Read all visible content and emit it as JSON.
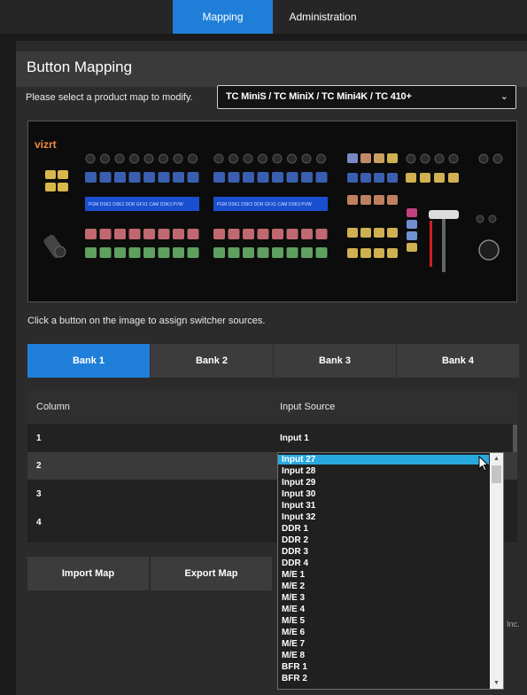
{
  "nav": {
    "tabs": [
      {
        "label": "Mapping",
        "active": true
      },
      {
        "label": "Administration",
        "active": false
      }
    ]
  },
  "panel": {
    "title": "Button Mapping"
  },
  "product": {
    "label": "Please select a product map to modify.",
    "selected": "TC MiniS / TC MiniX / TC Mini4K / TC 410+"
  },
  "device": {
    "logo": "vizrt",
    "row_labels": [
      "PGM",
      "DSK1",
      "DSK2",
      "DDR",
      "GFX1",
      "CAM",
      "DSK3",
      "PVW"
    ]
  },
  "hint": "Click a button on the image to assign switcher sources.",
  "banks": [
    {
      "label": "Bank 1",
      "active": true
    },
    {
      "label": "Bank 2",
      "active": false
    },
    {
      "label": "Bank 3",
      "active": false
    },
    {
      "label": "Bank 4",
      "active": false
    }
  ],
  "table": {
    "headers": {
      "column": "Column",
      "source": "Input Source"
    },
    "rows": [
      {
        "column": "1",
        "source": "Input 1"
      },
      {
        "column": "2",
        "source": ""
      },
      {
        "column": "3",
        "source": ""
      },
      {
        "column": "4",
        "source": ""
      }
    ]
  },
  "actions": {
    "import": "Import Map",
    "export": "Export Map"
  },
  "footer": {
    "copyright_fragment": "Inc."
  },
  "dropdown": {
    "selected": "Input 27",
    "options": [
      "Input 27",
      "Input 28",
      "Input 29",
      "Input 30",
      "Input 31",
      "Input 32",
      "DDR 1",
      "DDR 2",
      "DDR 3",
      "DDR 4",
      "M/E 1",
      "M/E 2",
      "M/E 3",
      "M/E 4",
      "M/E 5",
      "M/E 6",
      "M/E 7",
      "M/E 8",
      "BFR 1",
      "BFR 2"
    ]
  },
  "colors": {
    "accent": "#1f7fd8",
    "highlight": "#29a8e0"
  }
}
